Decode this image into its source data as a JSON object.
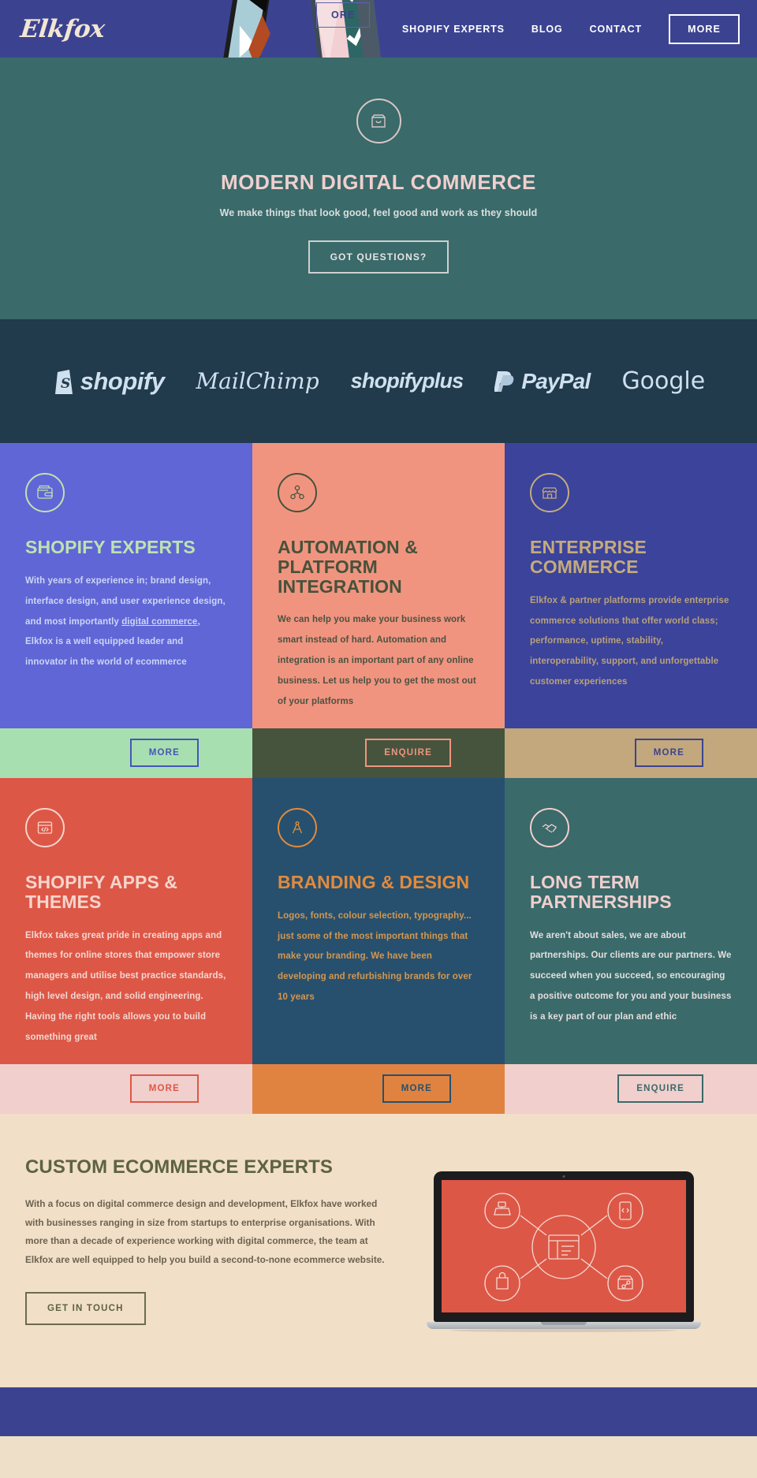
{
  "header": {
    "logo_text": "Elkfox",
    "ghost_button_label": "ORE",
    "nav": [
      {
        "label": "SHOPIFY EXPERTS",
        "name": "nav-shopify-experts"
      },
      {
        "label": "BLOG",
        "name": "nav-blog"
      },
      {
        "label": "CONTACT",
        "name": "nav-contact"
      }
    ],
    "cta_label": "MORE"
  },
  "hero": {
    "icon": "shopping-bag-icon",
    "title": "MODERN DIGITAL COMMERCE",
    "subtitle": "We make things that look good, feel good and work as they should",
    "button_label": "GOT QUESTIONS?",
    "bg_color": "#3a6a6a",
    "title_color": "#f0cfce"
  },
  "partners": {
    "bg_color": "#213a4c",
    "logo_color": "#cfe0ee",
    "items": [
      {
        "name": "shopify-logo",
        "text": "shopify"
      },
      {
        "name": "mailchimp-logo",
        "text": "MailChimp"
      },
      {
        "name": "shopify-plus-logo",
        "text": "shopify",
        "suffix": "plus"
      },
      {
        "name": "paypal-logo",
        "text": "PayPal"
      },
      {
        "name": "google-logo",
        "text": "Google"
      }
    ]
  },
  "services": [
    {
      "name": "card-shopify-experts",
      "icon": "wallet-icon",
      "title": "SHOPIFY EXPERTS",
      "body_before": "With years of experience in; brand design, interface design, and user experience design, and most importantly ",
      "body_link": "digital commerce",
      "body_after": ", Elkfox is a well equipped leader and innovator in the world of ecommerce",
      "bg": "#6166d6",
      "title_color": "#bde3b0",
      "body_color": "#cbd6f5",
      "action_label": "MORE",
      "action_bg": "#a8dfb1",
      "action_color": "#4655b8"
    },
    {
      "name": "card-automation",
      "icon": "integration-nodes-icon",
      "title": "AUTOMATION & PLATFORM INTEGRATION",
      "body": "We can help you make your business work smart instead of hard. Automation and integration is an important part of any online business. Let us help you to get the most out of your platforms",
      "bg": "#f09480",
      "title_color": "#47523a",
      "body_color": "#4b5240",
      "action_label": "ENQUIRE",
      "action_bg": "#46543d",
      "action_color": "#f0947f"
    },
    {
      "name": "card-enterprise-commerce",
      "icon": "storefront-icon",
      "title": "ENTERPRISE COMMERCE",
      "body": "Elkfox & partner platforms provide enterprise commerce solutions that offer world class; performance, uptime, stability, interoperability, support, and unforgettable customer experiences",
      "bg": "#3b439b",
      "title_color": "#c5ab7c",
      "body_color": "#b9a17a",
      "action_label": "MORE",
      "action_bg": "#c2a87c",
      "action_color": "#3b4391"
    },
    {
      "name": "card-apps-themes",
      "icon": "code-window-icon",
      "title": "SHOPIFY APPS & THEMES",
      "body": "Elkfox takes great pride in creating apps and themes for online stores that empower store managers and utilise best practice standards, high level design, and solid engineering. Having the right tools allows you to build something great",
      "bg": "#dd5746",
      "title_color": "#f6d4cd",
      "body_color": "#f3d7d1",
      "action_label": "MORE",
      "action_bg": "#f0cfcd",
      "action_color": "#dd5746"
    },
    {
      "name": "card-branding-design",
      "icon": "compass-icon",
      "title": "BRANDING & DESIGN",
      "body": "Logos, fonts, colour selection, typography... just some of the most important things that make your branding. We have been developing and refurbishing brands for over 10 years",
      "bg": "#27506e",
      "title_color": "#e08b3f",
      "body_color": "#d4974f",
      "action_label": "MORE",
      "action_bg": "#e08341",
      "action_color": "#27506e"
    },
    {
      "name": "card-long-term-partnerships",
      "icon": "handshake-icon",
      "title": "LONG TERM PARTNERSHIPS",
      "body": "We aren't about sales, we are about partnerships. Our clients are our partners. We succeed when you succeed, so encouraging a positive outcome for you and your business is a key part of our plan and ethic",
      "bg": "#3a6a6a",
      "title_color": "#f0cfce",
      "body_color": "#e6dede",
      "action_label": "ENQUIRE",
      "action_bg": "#f0cfcd",
      "action_color": "#3a6a6a"
    }
  ],
  "custom": {
    "title": "CUSTOM ECOMMERCE EXPERTS",
    "body": "With a focus on digital commerce design and development, Elkfox have worked with businesses ranging in size from startups to enterprise organisations. With more than a decade of experience working with digital commerce, the team at Elkfox are well equipped to help you build a second-to-none ecommerce website.",
    "button_label": "GET IN TOUCH",
    "bg_color": "#f2dfc8",
    "laptop": {
      "screen_color": "#dd5746",
      "center_icon": "dashboard-window-icon",
      "node_icons": [
        "cash-register-icon",
        "mobile-code-icon",
        "shopping-bag-icon",
        "share-box-icon"
      ]
    }
  },
  "footer": {
    "bg_color": "#3b4391"
  }
}
